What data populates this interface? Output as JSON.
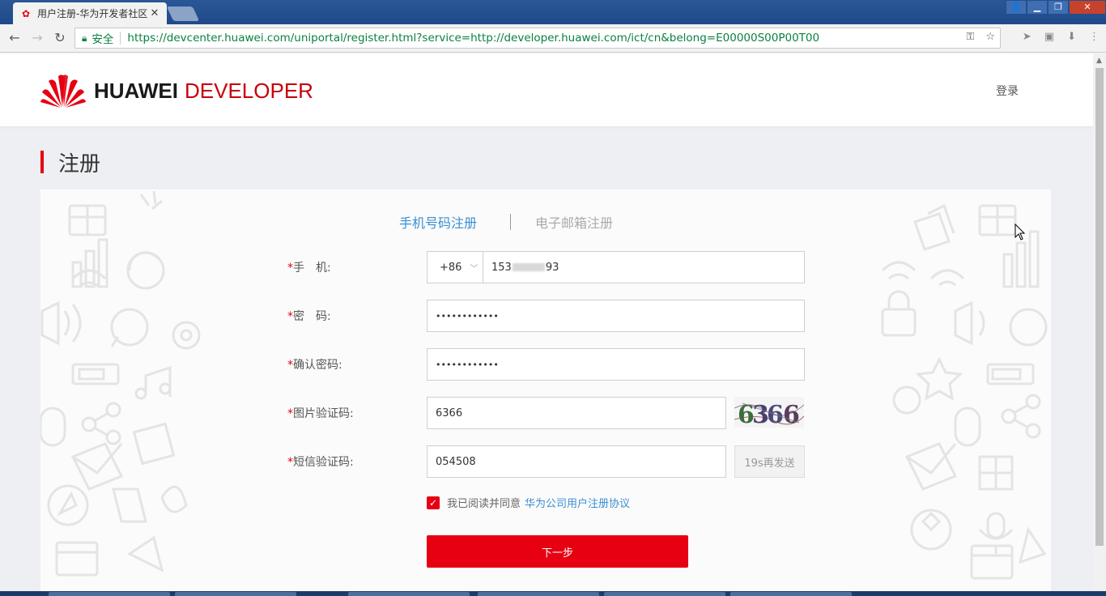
{
  "browser": {
    "tab_title": "用户注册-华为开发者社区",
    "tab_close": "✕",
    "secure_label": "安全",
    "url_host": "https://devcenter.huawei.com",
    "url_rest": "/uniportal/register.html?service=http://developer.huawei.com/ict/cn&belong=E00000S00P00T00",
    "window_controls": {
      "minimize": "▁",
      "restore": "❐",
      "close": "✕"
    }
  },
  "header": {
    "logo_word": "HUAWEI",
    "logo_sub": "DEVELOPER",
    "login_label": "登录"
  },
  "page": {
    "title": "注册"
  },
  "form": {
    "tab_phone": "手机号码注册",
    "tab_email": "电子邮箱注册",
    "required_mark": "*",
    "phone_label": "手　机:",
    "country_code": "+86",
    "phone_prefix": "153",
    "phone_suffix": "93",
    "password_label": "密　码:",
    "password_value": "••••••••••••",
    "confirm_label": "确认密码:",
    "confirm_value": "••••••••••••",
    "captcha_label": "图片验证码:",
    "captcha_value": "6366",
    "sms_label": "短信验证码:",
    "sms_value": "054508",
    "resend_label": "19s再发送",
    "agree_text": "我已阅读并同意",
    "agree_link": "华为公司用户注册协议",
    "agree_checked": true,
    "next_label": "下一步"
  },
  "colors": {
    "brand_red": "#e60012",
    "link_blue": "#3a8fd3"
  }
}
